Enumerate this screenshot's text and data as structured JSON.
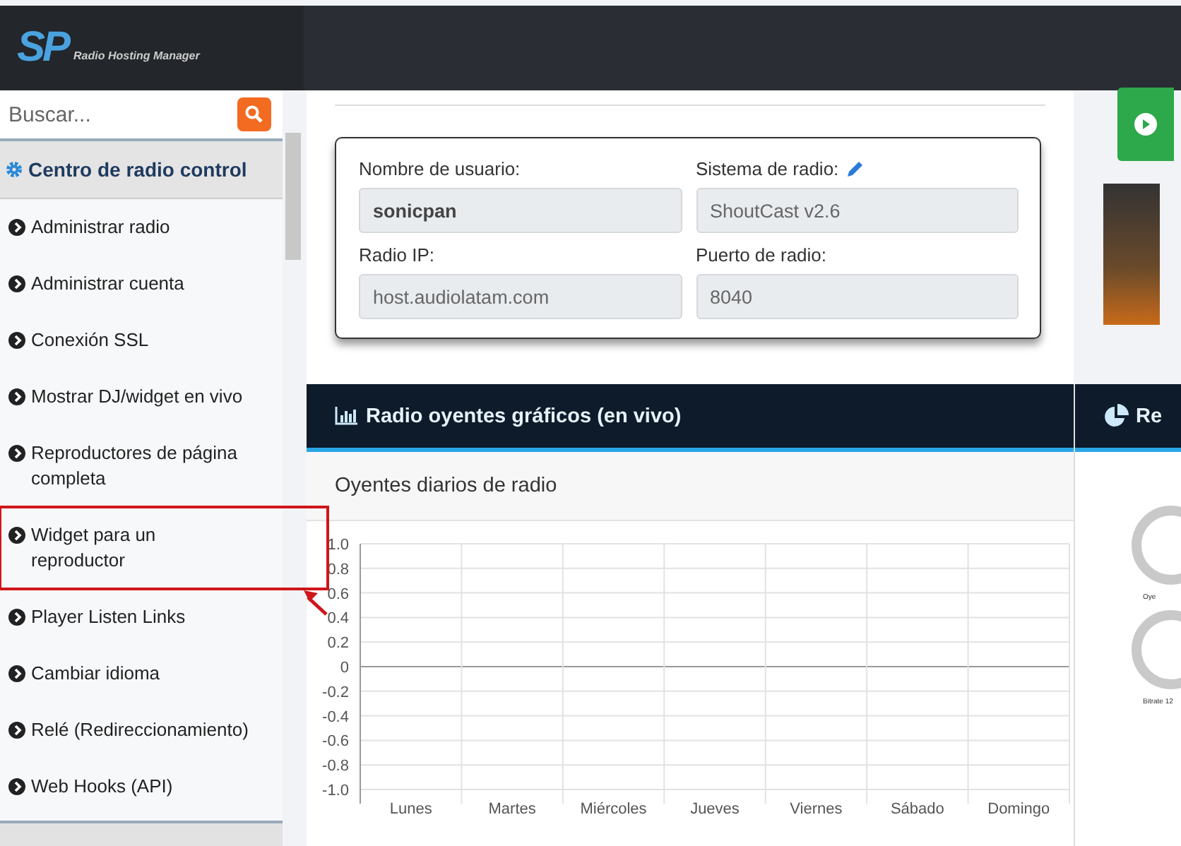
{
  "header": {
    "logo_mark": "SP",
    "logo_text": "Radio Hosting Manager"
  },
  "sidebar": {
    "search": {
      "placeholder": "Buscar..."
    },
    "section_title": "Centro de radio control",
    "items": [
      {
        "label": "Administrar radio",
        "highlighted": false
      },
      {
        "label": "Administrar cuenta",
        "highlighted": false
      },
      {
        "label": "Conexión SSL",
        "highlighted": false
      },
      {
        "label": "Mostrar DJ/widget en vivo",
        "highlighted": false
      },
      {
        "label": "Reproductores de página completa",
        "highlighted": false
      },
      {
        "label": "Widget para un reproductor",
        "highlighted": true
      },
      {
        "label": "Player Listen Links",
        "highlighted": false
      },
      {
        "label": "Cambiar idioma",
        "highlighted": false
      },
      {
        "label": "Relé (Redireccionamiento)",
        "highlighted": false
      },
      {
        "label": "Web Hooks (API)",
        "highlighted": false
      }
    ]
  },
  "info": {
    "fields": [
      {
        "label": "Nombre de usuario:",
        "value": "sonicpan",
        "kind": "bold"
      },
      {
        "label": "Sistema de radio:",
        "value": "ShoutCast v2.6",
        "kind": "editable"
      },
      {
        "label": "Radio IP:",
        "value": "host.audiolatam.com",
        "kind": "plain"
      },
      {
        "label": "Puerto de radio:",
        "value": "8040",
        "kind": "plain"
      }
    ]
  },
  "listeners_panel": {
    "title": "Radio oyentes gráficos (en vivo)",
    "subtitle": "Oyentes diarios de radio",
    "chart_data": {
      "type": "line",
      "grid": true,
      "categories": [
        "Lunes",
        "Martes",
        "Miércoles",
        "Jueves",
        "Viernes",
        "Sábado",
        "Domingo"
      ],
      "ylim": [
        -1,
        1
      ],
      "yticks": [
        {
          "value": 1,
          "label": "1.0"
        },
        0.8,
        0.6,
        0.4,
        0.2,
        0,
        -0.2,
        -0.4,
        -0.6,
        -0.8,
        {
          "value": -1,
          "label": "-1.0"
        }
      ]
    }
  },
  "side_panel": {
    "title": "Re",
    "donut_labels": [
      "Oye",
      "Bitrate 12"
    ]
  }
}
